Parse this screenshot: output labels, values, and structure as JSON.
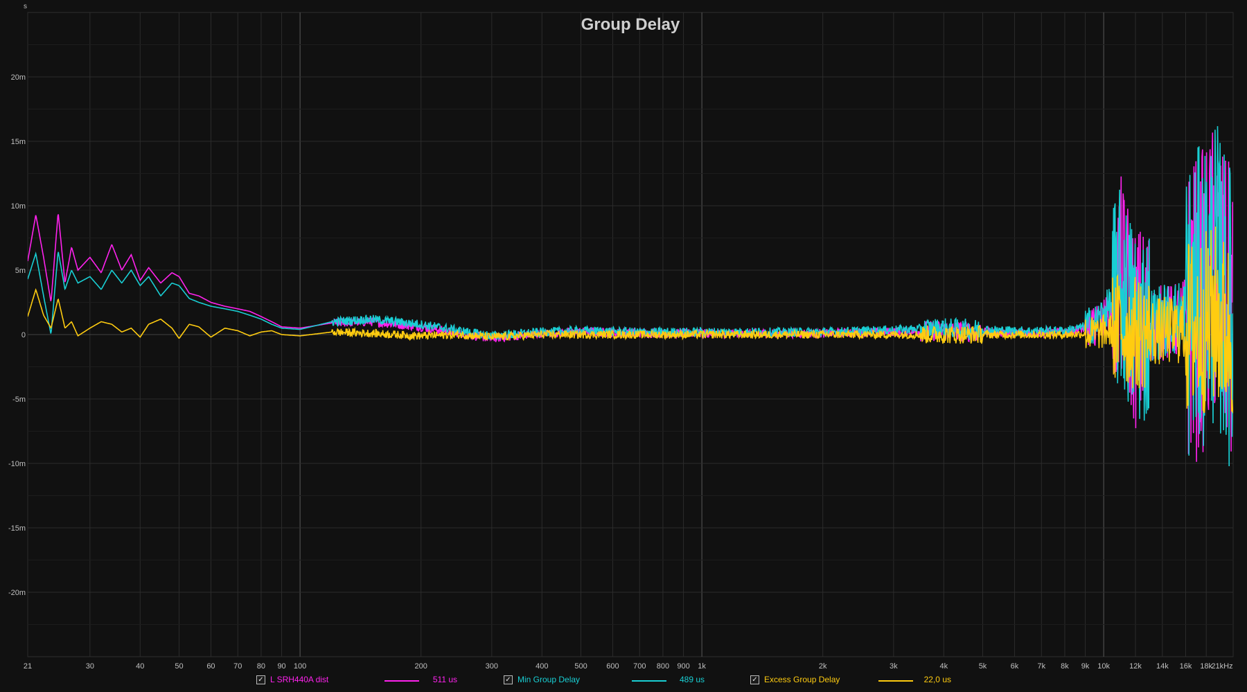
{
  "chart_data": {
    "type": "line",
    "title": "Group Delay",
    "ylabel": "s",
    "xlabel": "",
    "x_scale": "log",
    "xlim": [
      21,
      21000
    ],
    "ylim": [
      -25,
      25
    ],
    "grid": true,
    "x_ticks": [
      {
        "v": 21,
        "t": "21"
      },
      {
        "v": 30,
        "t": "30"
      },
      {
        "v": 40,
        "t": "40"
      },
      {
        "v": 50,
        "t": "50"
      },
      {
        "v": 60,
        "t": "60"
      },
      {
        "v": 70,
        "t": "70"
      },
      {
        "v": 80,
        "t": "80"
      },
      {
        "v": 90,
        "t": "90"
      },
      {
        "v": 100,
        "t": "100"
      },
      {
        "v": 200,
        "t": "200"
      },
      {
        "v": 300,
        "t": "300"
      },
      {
        "v": 400,
        "t": "400"
      },
      {
        "v": 500,
        "t": "500"
      },
      {
        "v": 600,
        "t": "600"
      },
      {
        "v": 700,
        "t": "700"
      },
      {
        "v": 800,
        "t": "800"
      },
      {
        "v": 900,
        "t": "900"
      },
      {
        "v": 1000,
        "t": "1k"
      },
      {
        "v": 2000,
        "t": "2k"
      },
      {
        "v": 3000,
        "t": "3k"
      },
      {
        "v": 4000,
        "t": "4k"
      },
      {
        "v": 5000,
        "t": "5k"
      },
      {
        "v": 6000,
        "t": "6k"
      },
      {
        "v": 7000,
        "t": "7k"
      },
      {
        "v": 8000,
        "t": "8k"
      },
      {
        "v": 9000,
        "t": "9k"
      },
      {
        "v": 10000,
        "t": "10k"
      },
      {
        "v": 12000,
        "t": "12k"
      },
      {
        "v": 14000,
        "t": "14k"
      },
      {
        "v": 16000,
        "t": "16k"
      },
      {
        "v": 18000,
        "t": "18k"
      },
      {
        "v": 21000,
        "t": "21kHz"
      }
    ],
    "y_ticks": [
      {
        "v": 20,
        "t": "20m"
      },
      {
        "v": 15,
        "t": "15m"
      },
      {
        "v": 10,
        "t": "10m"
      },
      {
        "v": 5,
        "t": "5m"
      },
      {
        "v": 0,
        "t": "0"
      },
      {
        "v": -5,
        "t": "-5m"
      },
      {
        "v": -10,
        "t": "-10m"
      },
      {
        "v": -15,
        "t": "-15m"
      },
      {
        "v": -20,
        "t": "-20m"
      }
    ],
    "series": [
      {
        "name": "L SRH440A dist",
        "color": "#ff22ee",
        "value": "511 us",
        "x": [
          21,
          22,
          23,
          24,
          25,
          26,
          27,
          28,
          30,
          32,
          34,
          36,
          38,
          40,
          42,
          45,
          48,
          50,
          53,
          56,
          60,
          65,
          70,
          75,
          80,
          85,
          90,
          100,
          120,
          150,
          200,
          250,
          300,
          400,
          500,
          700,
          1000,
          2000,
          4000,
          6000,
          8000,
          9500,
          10500,
          11000,
          12000,
          13000,
          15000,
          17000,
          18000,
          19000,
          20000,
          21000
        ],
        "y": [
          5.7,
          9.3,
          6.0,
          2.5,
          9.5,
          4.0,
          6.8,
          5.0,
          6.0,
          4.8,
          7.0,
          5.0,
          6.2,
          4.2,
          5.2,
          4.0,
          4.8,
          4.5,
          3.2,
          3.0,
          2.5,
          2.2,
          2.0,
          1.8,
          1.4,
          1.0,
          0.6,
          0.5,
          0.9,
          1.0,
          0.6,
          0.1,
          -0.3,
          0.1,
          0.2,
          0.1,
          0.1,
          0.1,
          0.3,
          0.1,
          0.2,
          0.6,
          2.0,
          4.5,
          0.5,
          0.8,
          1.0,
          2.0,
          3.0,
          5.0,
          2.0,
          1.0
        ]
      },
      {
        "name": "Min Group Delay",
        "color": "#19cfd4",
        "value": "489 us",
        "x": [
          21,
          22,
          23,
          24,
          25,
          26,
          27,
          28,
          30,
          32,
          34,
          36,
          38,
          40,
          42,
          45,
          48,
          50,
          53,
          56,
          60,
          65,
          70,
          75,
          80,
          85,
          90,
          100,
          120,
          150,
          200,
          250,
          300,
          400,
          500,
          700,
          1000,
          2000,
          4000,
          6000,
          8000,
          9500,
          10500,
          11000,
          12000,
          13000,
          15000,
          17000,
          18000,
          19000,
          20000,
          21000
        ],
        "y": [
          4.3,
          6.3,
          3.0,
          0.0,
          6.5,
          3.5,
          5.0,
          4.0,
          4.5,
          3.5,
          5.0,
          4.0,
          5.0,
          3.8,
          4.5,
          3.0,
          4.0,
          3.8,
          2.8,
          2.5,
          2.2,
          2.0,
          1.8,
          1.5,
          1.2,
          0.8,
          0.5,
          0.4,
          1.0,
          1.2,
          0.8,
          0.3,
          -0.1,
          0.2,
          0.3,
          0.2,
          0.2,
          0.2,
          0.5,
          0.3,
          0.3,
          0.8,
          2.5,
          3.5,
          0.6,
          0.9,
          1.2,
          2.4,
          3.5,
          5.0,
          2.5,
          1.0
        ]
      },
      {
        "name": "Excess Group Delay",
        "color": "#ffcc10",
        "value": "22,0 us",
        "x": [
          21,
          22,
          23,
          24,
          25,
          26,
          27,
          28,
          30,
          32,
          34,
          36,
          38,
          40,
          42,
          45,
          48,
          50,
          53,
          56,
          60,
          65,
          70,
          75,
          80,
          85,
          90,
          100,
          120,
          150,
          200,
          250,
          300,
          400,
          500,
          700,
          1000,
          2000,
          4000,
          6000,
          8000,
          9500,
          10500,
          11000,
          12000,
          13000,
          15000,
          17000,
          18000,
          19000,
          20000,
          21000
        ],
        "y": [
          1.4,
          3.5,
          1.5,
          0.5,
          2.8,
          0.5,
          1.0,
          -0.1,
          0.5,
          1.0,
          0.8,
          0.2,
          0.5,
          -0.2,
          0.8,
          1.2,
          0.5,
          -0.3,
          0.8,
          0.6,
          -0.2,
          0.5,
          0.3,
          -0.1,
          0.2,
          0.3,
          0.0,
          -0.1,
          0.2,
          0.1,
          -0.1,
          0.0,
          -0.2,
          0.0,
          0.0,
          0.0,
          0.0,
          0.0,
          0.0,
          0.0,
          0.0,
          0.1,
          0.3,
          0.5,
          0.1,
          0.2,
          0.3,
          0.6,
          1.0,
          1.5,
          0.6,
          0.2
        ]
      }
    ]
  }
}
